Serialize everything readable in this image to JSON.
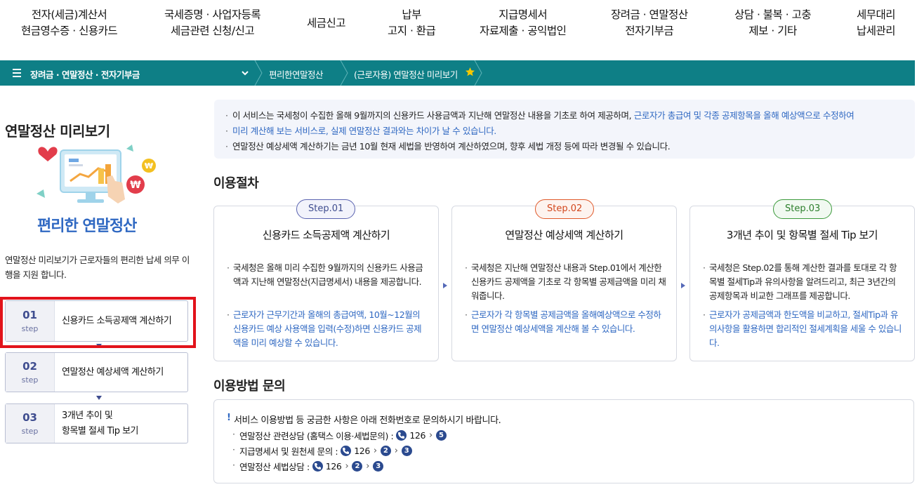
{
  "topnav": {
    "items": [
      {
        "line1": "전자(세금)계산서",
        "line2": "현금영수증 · 신용카드"
      },
      {
        "line1": "국세증명 · 사업자등록",
        "line2": "세금관련 신청/신고"
      },
      {
        "line1": "세금신고",
        "line2": ""
      },
      {
        "line1": "납부",
        "line2": "고지 · 환급"
      },
      {
        "line1": "지급명세서",
        "line2": "자료제출 · 공익법인"
      },
      {
        "line1": "장려금 · 연말정산",
        "line2": "전자기부금"
      },
      {
        "line1": "상담 · 불복 · 고충",
        "line2": "제보 · 기타"
      },
      {
        "line1": "세무대리",
        "line2": "납세관리"
      }
    ]
  },
  "breadcrumb": {
    "section": "장려금 · 연말정산 · 전자기부금",
    "level2": "편리한연말정산",
    "level3": "(근로자용) 연말정산 미리보기"
  },
  "left": {
    "title": "연말정산 미리보기",
    "illus_caption": "편리한 연말정산",
    "description": "연말정산 미리보기가 근로자들의  편리한 납세 의무 이행을 지원 합니다.",
    "steps": [
      {
        "num": "01",
        "step": "step",
        "label": "신용카드 소득공제액 계산하기"
      },
      {
        "num": "02",
        "step": "step",
        "label": "연말정산 예상세액 계산하기"
      },
      {
        "num": "03",
        "step": "step",
        "label_line1": "3개년 추이 및",
        "label_line2": "항목별 절세 Tip 보기"
      }
    ]
  },
  "info": {
    "line1_a": "이 서비스는 국세청이 수집한 올해 9월까지의 신용카드 사용금액과 지난해 연말정산 내용을 기초로 하여 제공하며, ",
    "line1_b": "근로자가 총급여 및 각종 공제항목을 올해 예상액으로 수정하여",
    "line1_c": "미리 계산해 보는 서비스로, 실제 연말정산 결과와는 차이가 날 수 있습니다.",
    "line2": "연말정산 예상세액 계산하기는 금년 10월 현재 세법을 반영하여 계산하였으며, 향후 세법 개정 등에 따라 변경될 수 있습니다."
  },
  "procedure": {
    "title": "이용절차",
    "cards": [
      {
        "pill": "Step.01",
        "title": "신용카드 소득공제액 계산하기",
        "p1": "국세청은 올해 미리 수집한 9월까지의 신용카드 사용금액과 지난해 연말정산(지급명세서) 내용을 제공합니다.",
        "p2": "근로자가 근무기간과 올해의 총급여액, 10월~12월의 신용카드 예상 사용액을 입력(수정)하면 신용카드 공제액을 미리 예상할 수 있습니다."
      },
      {
        "pill": "Step.02",
        "title": "연말정산 예상세액 계산하기",
        "p1": "국세청은 지난해 연말정산 내용과 Step.01에서 계산한 신용카드 공제액을 기초로 각 항목별 공제금액을 미리 채워줍니다.",
        "p2": "근로자가 각 항목별 공제금액을 올해예상액으로 수정하면 연말정산 예상세액을 계산해 볼 수 있습니다."
      },
      {
        "pill": "Step.03",
        "title": "3개년 추이 및 항목별 절세 Tip 보기",
        "p1": "국세청은 Step.02를 통해 계산한 결과를 토대로 각 항목별 절세Tip과 유의사항을 알려드리고, 최근 3년간의 공제항목과 비교한 그래프를 제공합니다.",
        "p2": "근로자가 공제금액과 한도액을 비교하고, 절세Tip과 유의사항을 활용하면 합리적인 절세계획을 세울 수 있습니다."
      }
    ]
  },
  "inquiry": {
    "title": "이용방법 문의",
    "head": "서비스 이용방법 등 궁금한 사항은 아래 전화번호로 문의하시기 바랍니다.",
    "lines": [
      {
        "label": "연말정산 관련상담 (홈택스 이용·세법문의) :",
        "phone": "126",
        "keys": [
          "5"
        ]
      },
      {
        "label": "지급명세서 및 원천세 문의 :",
        "phone": "126",
        "keys": [
          "2",
          "3"
        ]
      },
      {
        "label": "연말정산 세법상담 :",
        "phone": "126",
        "keys": [
          "2",
          "3"
        ]
      }
    ]
  },
  "colors": {
    "crumb_bg": "#0e7f86",
    "accent_blue": "#2f68c2",
    "highlight_red": "#e2131b",
    "step01_pill": "#5a63b0",
    "step02_pill": "#e0592a",
    "step03_pill": "#3b9a3b"
  }
}
